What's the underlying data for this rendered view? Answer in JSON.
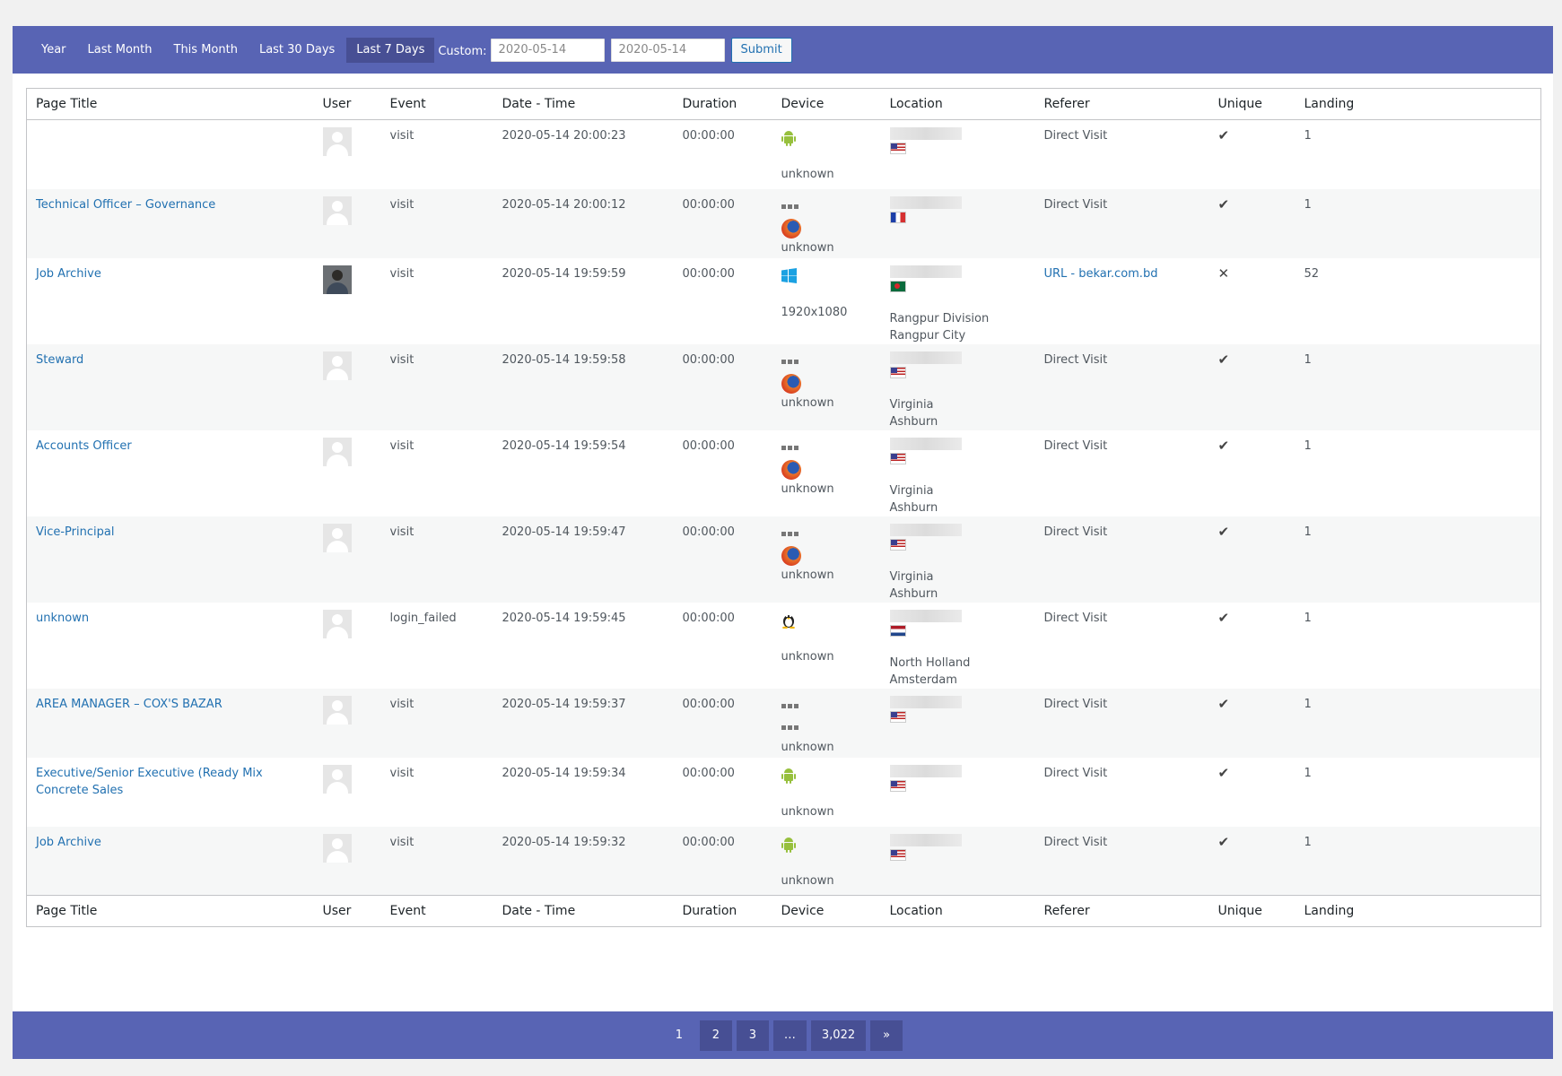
{
  "filter": {
    "ranges": [
      {
        "label": "Year"
      },
      {
        "label": "Last Month"
      },
      {
        "label": "This Month"
      },
      {
        "label": "Last 30 Days"
      },
      {
        "label": "Last 7 Days",
        "active": true
      }
    ],
    "custom_label": "Custom:",
    "start_date": "2020-05-14",
    "end_date": "2020-05-14",
    "submit_label": "Submit"
  },
  "table": {
    "columns": [
      "Page Title",
      "User",
      "Event",
      "Date - Time",
      "Duration",
      "Device",
      "Location",
      "Referer",
      "Unique",
      "Landing"
    ],
    "rows": [
      {
        "page_title": "",
        "avatar": "default",
        "event": "visit",
        "datetime": "2020-05-14 20:00:23",
        "duration": "00:00:00",
        "device_icons": [
          "android-icon"
        ],
        "device_text": "unknown",
        "flag": "us",
        "location": [],
        "referer": "Direct Visit",
        "unique": true,
        "landing": "1"
      },
      {
        "page_title": "Technical Officer – Governance",
        "avatar": "default",
        "event": "visit",
        "datetime": "2020-05-14 20:00:12",
        "duration": "00:00:00",
        "device_icons": [
          "unknown-ua-icon",
          "firefox-icon"
        ],
        "device_text": "unknown",
        "flag": "fr",
        "location": [],
        "referer": "Direct Visit",
        "unique": true,
        "landing": "1"
      },
      {
        "page_title": "Job Archive",
        "avatar": "photo",
        "event": "visit",
        "datetime": "2020-05-14 19:59:59",
        "duration": "00:00:00",
        "device_icons": [
          "windows-icon"
        ],
        "device_text": "1920x1080",
        "flag": "bd",
        "location": [
          "Rangpur Division",
          "Rangpur City"
        ],
        "referer": "URL - bekar.com.bd",
        "unique": false,
        "landing": "52"
      },
      {
        "page_title": "Steward",
        "avatar": "default",
        "event": "visit",
        "datetime": "2020-05-14 19:59:58",
        "duration": "00:00:00",
        "device_icons": [
          "unknown-ua-icon",
          "firefox-icon"
        ],
        "device_text": "unknown",
        "flag": "us",
        "location": [
          "Virginia",
          "Ashburn"
        ],
        "referer": "Direct Visit",
        "unique": true,
        "landing": "1"
      },
      {
        "page_title": "Accounts Officer",
        "avatar": "default",
        "event": "visit",
        "datetime": "2020-05-14 19:59:54",
        "duration": "00:00:00",
        "device_icons": [
          "unknown-ua-icon",
          "firefox-icon"
        ],
        "device_text": "unknown",
        "flag": "us",
        "location": [
          "Virginia",
          "Ashburn"
        ],
        "referer": "Direct Visit",
        "unique": true,
        "landing": "1"
      },
      {
        "page_title": "Vice-Principal",
        "avatar": "default",
        "event": "visit",
        "datetime": "2020-05-14 19:59:47",
        "duration": "00:00:00",
        "device_icons": [
          "unknown-ua-icon",
          "firefox-icon"
        ],
        "device_text": "unknown",
        "flag": "us",
        "location": [
          "Virginia",
          "Ashburn"
        ],
        "referer": "Direct Visit",
        "unique": true,
        "landing": "1"
      },
      {
        "page_title": "unknown",
        "avatar": "default",
        "event": "login_failed",
        "datetime": "2020-05-14 19:59:45",
        "duration": "00:00:00",
        "device_icons": [
          "linux-icon"
        ],
        "device_text": "unknown",
        "flag": "nl",
        "location": [
          "North Holland",
          "Amsterdam"
        ],
        "referer": "Direct Visit",
        "unique": true,
        "landing": "1"
      },
      {
        "page_title": "AREA MANAGER – COX'S BAZAR",
        "avatar": "default",
        "event": "visit",
        "datetime": "2020-05-14 19:59:37",
        "duration": "00:00:00",
        "device_icons": [
          "unknown-ua-icon",
          "unknown-ua-icon"
        ],
        "device_text": "unknown",
        "flag": "us",
        "location": [],
        "referer": "Direct Visit",
        "unique": true,
        "landing": "1"
      },
      {
        "page_title": "Executive/Senior Executive (Ready Mix Concrete Sales",
        "avatar": "default",
        "event": "visit",
        "datetime": "2020-05-14 19:59:34",
        "duration": "00:00:00",
        "device_icons": [
          "android-icon"
        ],
        "device_text": "unknown",
        "flag": "us",
        "location": [],
        "referer": "Direct Visit",
        "unique": true,
        "landing": "1"
      },
      {
        "page_title": "Job Archive",
        "avatar": "default",
        "event": "visit",
        "datetime": "2020-05-14 19:59:32",
        "duration": "00:00:00",
        "device_icons": [
          "android-icon"
        ],
        "device_text": "unknown",
        "flag": "us",
        "location": [],
        "referer": "Direct Visit",
        "unique": true,
        "landing": "1"
      }
    ]
  },
  "pagination": {
    "current": "1",
    "pages": [
      "2",
      "3",
      "…",
      "3,022"
    ],
    "next": "»"
  }
}
